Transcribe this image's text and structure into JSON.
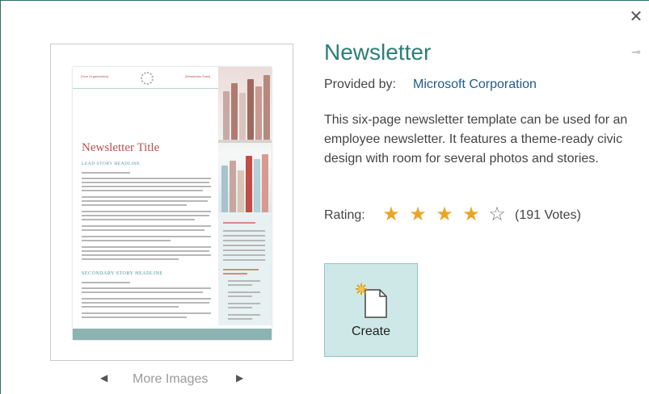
{
  "dialog": {
    "close_icon": "close-icon",
    "pin_icon": "pin-icon"
  },
  "preview": {
    "doc": {
      "header_left": "[Your Organization]",
      "header_right": "[Newsletter Date]",
      "title": "Newsletter Title",
      "lead_headline": "LEAD STORY HEADLINE",
      "secondary_headline": "SECONDARY STORY HEADLINE"
    },
    "more_images_label": "More Images",
    "prev_icon": "triangle-left-icon",
    "next_icon": "triangle-right-icon"
  },
  "details": {
    "title": "Newsletter",
    "provided_by_label": "Provided by:",
    "provider": "Microsoft Corporation",
    "description": "This six-page newsletter template can be used for an employee newsletter. It features a theme-ready civic design with room for several photos and stories.",
    "rating_label": "Rating:",
    "rating": 4,
    "rating_max": 5,
    "votes": "(191 Votes)"
  },
  "create": {
    "label": "Create",
    "icon": "new-document-icon"
  },
  "colors": {
    "accent": "#2d7d78",
    "link": "#1e5b8c",
    "star": "#e9a52b",
    "create_bg": "#cde8e6"
  }
}
